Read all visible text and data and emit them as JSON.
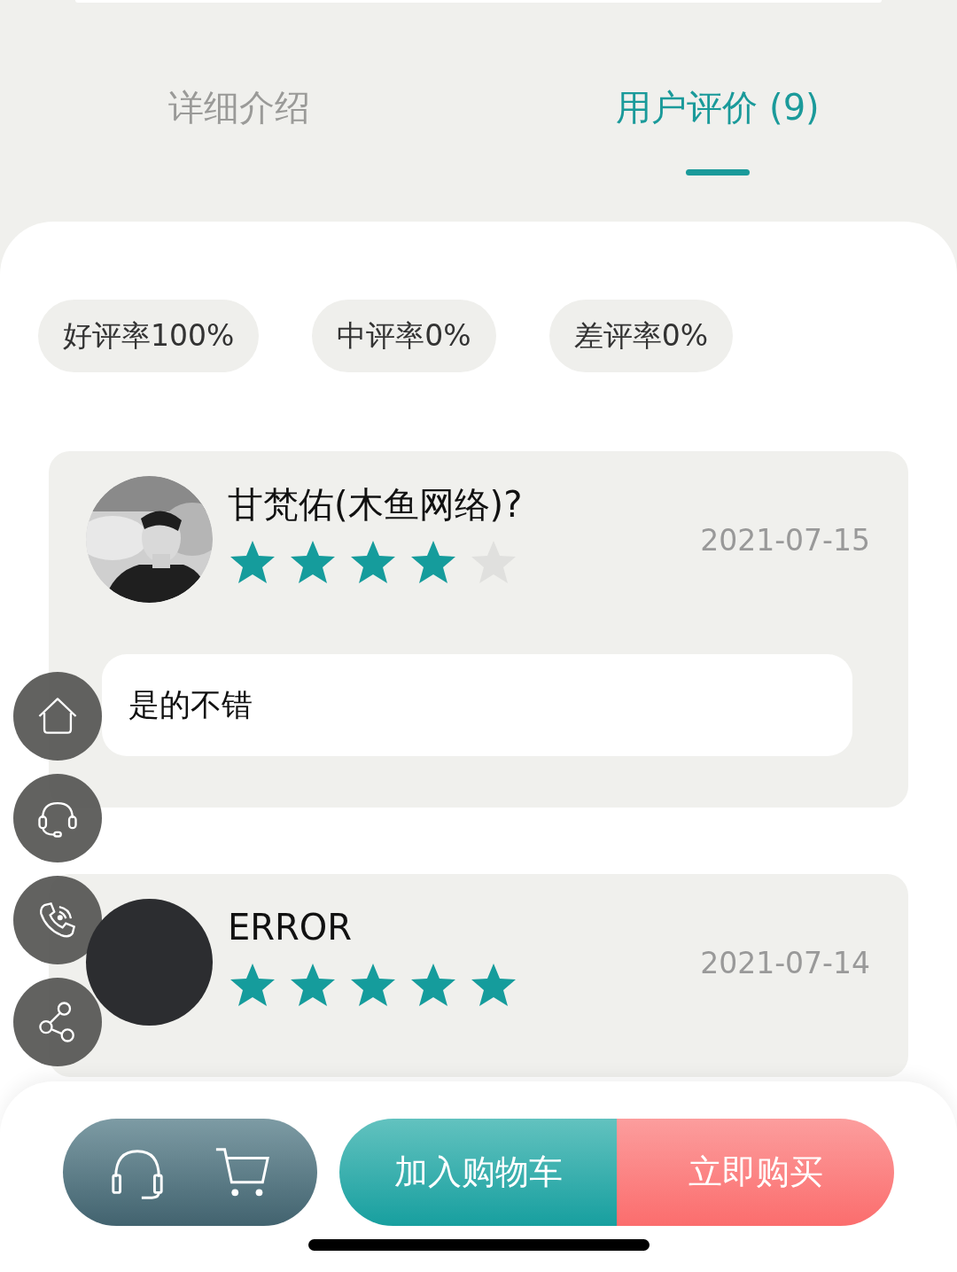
{
  "tabs": [
    {
      "label": "详细介绍",
      "selected": false
    },
    {
      "label": "用户评价 (9)",
      "selected": true
    }
  ],
  "rating_filters": [
    {
      "label": "好评率100%"
    },
    {
      "label": "中评率0%"
    },
    {
      "label": "差评率0%"
    }
  ],
  "reviews": [
    {
      "name": "甘梵佑(木鱼网络)?",
      "date": "2021-07-15",
      "stars": 4,
      "comment": "是的不错"
    },
    {
      "name": "ERROR",
      "date": "2021-07-14",
      "stars": 5,
      "avatar": {
        "kind": "blank"
      }
    }
  ],
  "bottom_bar": {
    "add_to_cart": "加入购物车",
    "buy_now": "立即购买"
  }
}
